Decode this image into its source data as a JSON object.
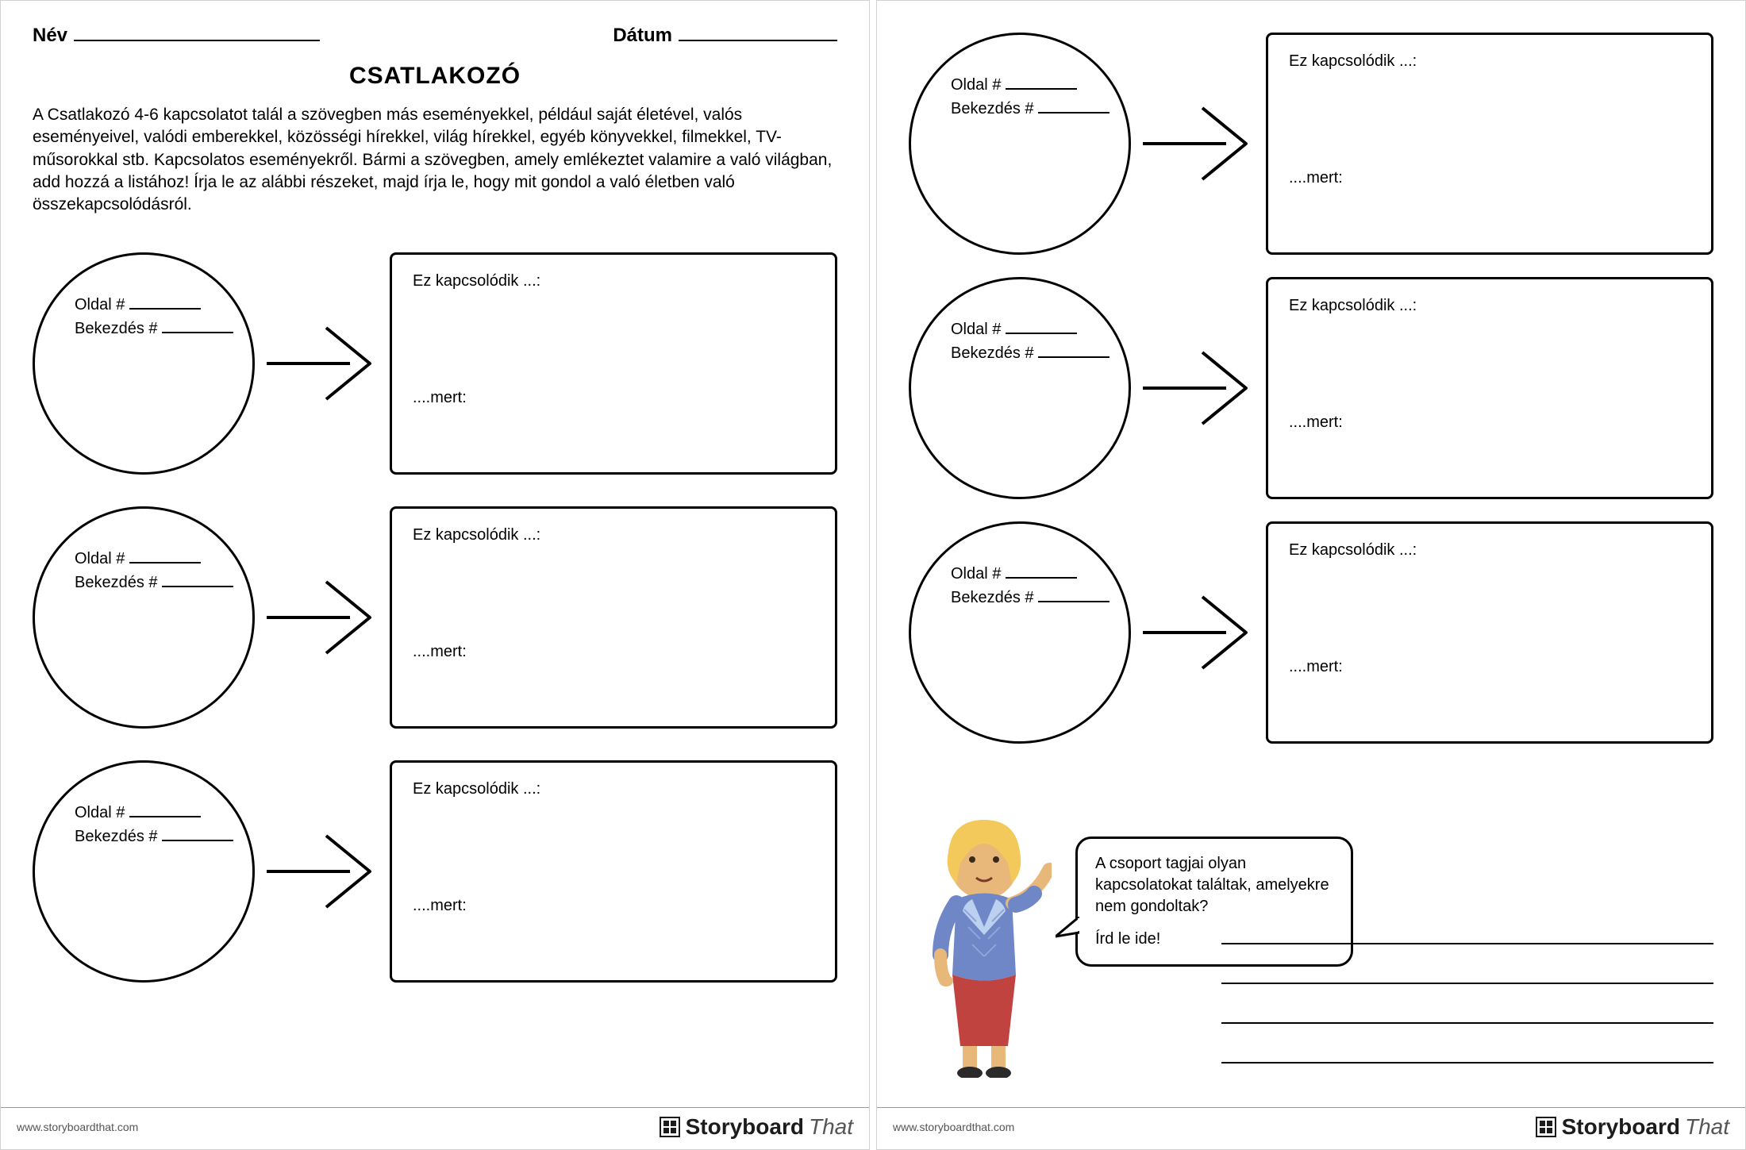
{
  "header": {
    "name_label": "Név",
    "date_label": "Dátum"
  },
  "title": "CSATLAKOZÓ",
  "instructions": "A Csatlakozó 4-6 kapcsolatot talál a szövegben más eseményekkel, például saját életével, valós eseményeivel, valódi emberekkel, közösségi hírekkel, világ hírekkel, egyéb könyvekkel, filmekkel, TV-műsorokkal stb. Kapcsolatos eseményekről. Bármi a szövegben, amely emlékeztet valamire a való világban, add hozzá a listához! Írja le az alábbi részeket, majd írja le, hogy mit gondol a való életben való összekapcsolódásról.",
  "circle_labels": {
    "page": "Oldal #",
    "paragraph": "Bekezdés #"
  },
  "box_labels": {
    "connects": "Ez kapcsolódik ...:",
    "because": "....mert:"
  },
  "speech": {
    "line1": "A csoport tagjai olyan kapcsolatokat találtak, amelyekre nem gondoltak?",
    "line2": "Írd le ide!"
  },
  "footer": {
    "url": "www.storyboardthat.com",
    "brand1": "Storyboard",
    "brand2": "That"
  }
}
